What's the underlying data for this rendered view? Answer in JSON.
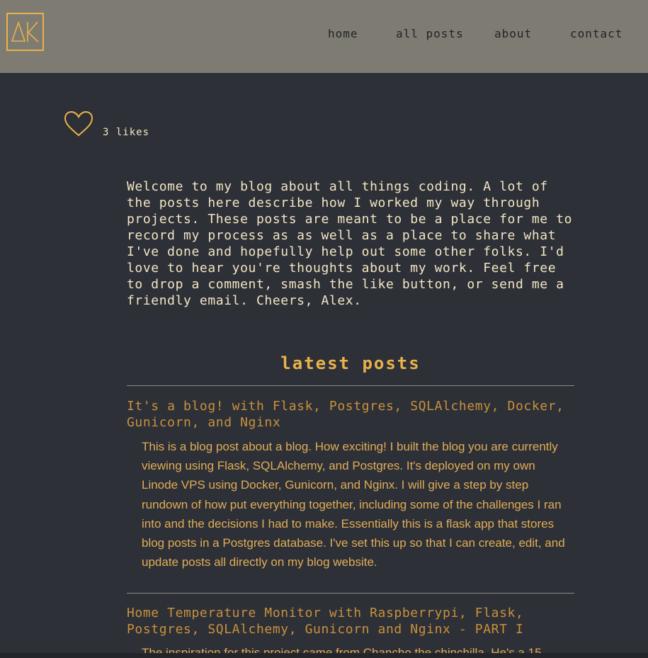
{
  "header": {
    "logo_text": "AK",
    "nav": [
      {
        "label": "home"
      },
      {
        "label": "all posts"
      },
      {
        "label": "about"
      },
      {
        "label": "contact"
      }
    ]
  },
  "likes": {
    "count_label": "3 likes",
    "icon": "heart-icon"
  },
  "intro": {
    "text": "Welcome to my blog about all things coding. A lot of the posts here describe how I worked my way through projects. These posts are meant to be a place for me to record my process as as well as a place to share what I've done and hopefully help out some other folks. I'd love to hear you're thoughts about my work. Feel free to drop a comment, smash the like button, or send me a friendly email. Cheers, Alex."
  },
  "latest": {
    "title": "latest posts",
    "posts": [
      {
        "title": "It's a blog! with Flask, Postgres, SQLAlchemy, Docker, Gunicorn, and Nginx",
        "excerpt": "This is a blog post about a blog. How exciting! I built the blog you are currently viewing using Flask, SQLAlchemy, and Postgres. It's deployed on my own Linode VPS using Docker, Gunicorn, and Nginx. I will give a step by step rundown of how put everything together, including some of the challenges I ran into and the decisions I had to make. Essentially this is a flask app that stores blog posts in a Postgres database. I've set this up so that I can create, edit, and update posts all directly on my blog website."
      },
      {
        "title": "Home Temperature Monitor with Raspberrypi, Flask, Postgres, SQLAlchemy, Gunicorn and Nginx - PART I",
        "excerpt": "The inspiration for this project came from Chancho the chinchilla. He's a 15"
      }
    ]
  },
  "colors": {
    "header_bg": "#7e7b72",
    "page_bg": "#2e3038",
    "accent": "#e9b24a",
    "text": "#f2e6c2",
    "post_title": "#c8913a",
    "nav_text": "#222327"
  }
}
